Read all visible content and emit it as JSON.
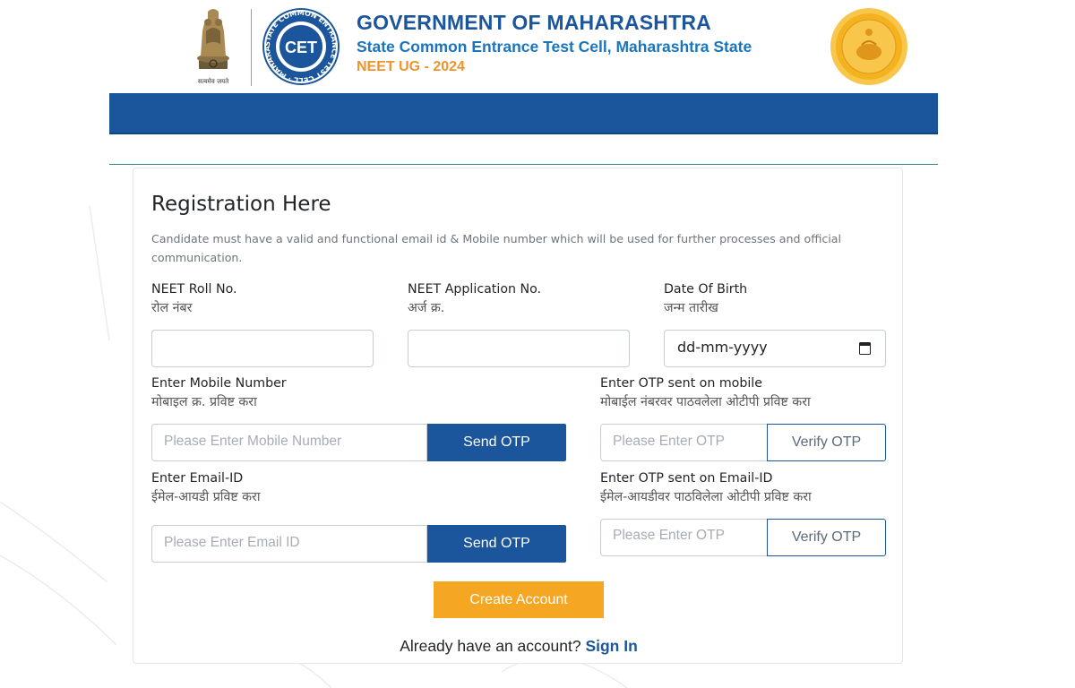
{
  "header": {
    "emblem_motto": "सत्यमेव जयते",
    "gov_title": "GOVERNMENT OF MAHARASHTRA",
    "cell_title": "State Common Entrance Test Cell, Maharashtra State",
    "exam_title": "NEET UG - 2024",
    "cet_logo_text": "CET",
    "cet_ring_text": "STATE COMMON ENTRANCE TEST CELL · MAHARASHTRA ·"
  },
  "form": {
    "title": "Registration Here",
    "note": "Candidate must have a valid and functional email id & Mobile number which will be used for further processes and official communication.",
    "roll": {
      "label_en": "NEET Roll No.",
      "label_mr": "रोल नंबर",
      "value": ""
    },
    "application": {
      "label_en": "NEET Application No.",
      "label_mr": "अर्ज क्र.",
      "value": ""
    },
    "dob": {
      "label_en": "Date Of Birth",
      "label_mr": "जन्म तारीख",
      "placeholder": "dd-mm-yyyy"
    },
    "mobile": {
      "label_en": "Enter Mobile Number",
      "label_mr": "मोबाइल क्र. प्रविष्ट करा",
      "placeholder": "Please Enter Mobile Number",
      "button": "Send OTP"
    },
    "mobile_otp": {
      "label_en": "Enter OTP sent on mobile",
      "label_mr": "मोबाईल नंबरवर पाठवलेला ओटीपी प्रविष्ट करा",
      "placeholder": "Please Enter OTP",
      "button": "Verify OTP"
    },
    "email": {
      "label_en": "Enter Email-ID",
      "label_mr": "ईमेल-आयडी प्रविष्ट करा",
      "placeholder": "Please Enter Email ID",
      "button": "Send OTP"
    },
    "email_otp": {
      "label_en": "Enter OTP sent on Email-ID",
      "label_mr": "ईमेल-आयडीवर पाठविलेला ओटीपी प्रविष्ट करा",
      "placeholder": "Please Enter OTP",
      "button": "Verify OTP"
    },
    "create_button": "Create Account",
    "signin_prompt": "Already have an account?",
    "signin_link": "Sign In"
  },
  "colors": {
    "brand_blue": "#1b569d",
    "accent_orange": "#f5a623",
    "teal_line": "#2e8b8b"
  }
}
